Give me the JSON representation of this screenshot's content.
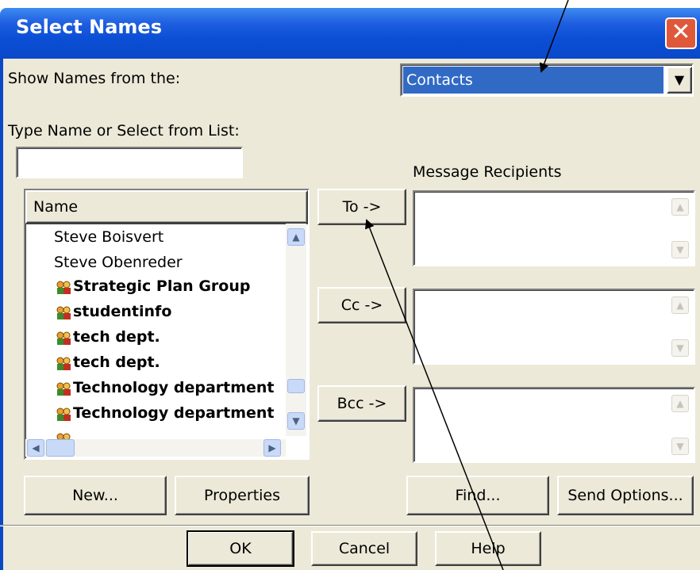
{
  "dialog": {
    "title": "Select Names",
    "close_glyph": "✕"
  },
  "show_names": {
    "label": "Show Names from the:",
    "selected": "Contacts",
    "arrow": "▼"
  },
  "search": {
    "label": "Type Name or Select from List:",
    "value": ""
  },
  "names_list": {
    "column_header": "Name",
    "items": [
      {
        "text": "Steve Boisvert",
        "type": "contact"
      },
      {
        "text": "Steve Obenreder",
        "type": "contact"
      },
      {
        "text": "Strategic Plan Group",
        "type": "group"
      },
      {
        "text": "studentinfo",
        "type": "group"
      },
      {
        "text": "tech dept.",
        "type": "group"
      },
      {
        "text": "tech dept.",
        "type": "group"
      },
      {
        "text": "Technology department",
        "type": "group"
      },
      {
        "text": "Technology department",
        "type": "group"
      }
    ]
  },
  "recipients": {
    "label": "Message Recipients",
    "to_button": "To ->",
    "cc_button": "Cc ->",
    "bcc_button": "Bcc ->"
  },
  "buttons": {
    "new": "New...",
    "properties": "Properties",
    "find": "Find...",
    "send_options": "Send Options...",
    "ok": "OK",
    "cancel": "Cancel",
    "help": "Help"
  },
  "icons": {
    "group": "group-people-icon",
    "scroll_up": "▲",
    "scroll_down": "▼",
    "scroll_left": "◀",
    "scroll_right": "▶"
  },
  "colors": {
    "titlebar": "#0a48c8",
    "dialog_bg": "#ece9d8",
    "selection": "#316ac5",
    "close_button": "#e0583a"
  }
}
